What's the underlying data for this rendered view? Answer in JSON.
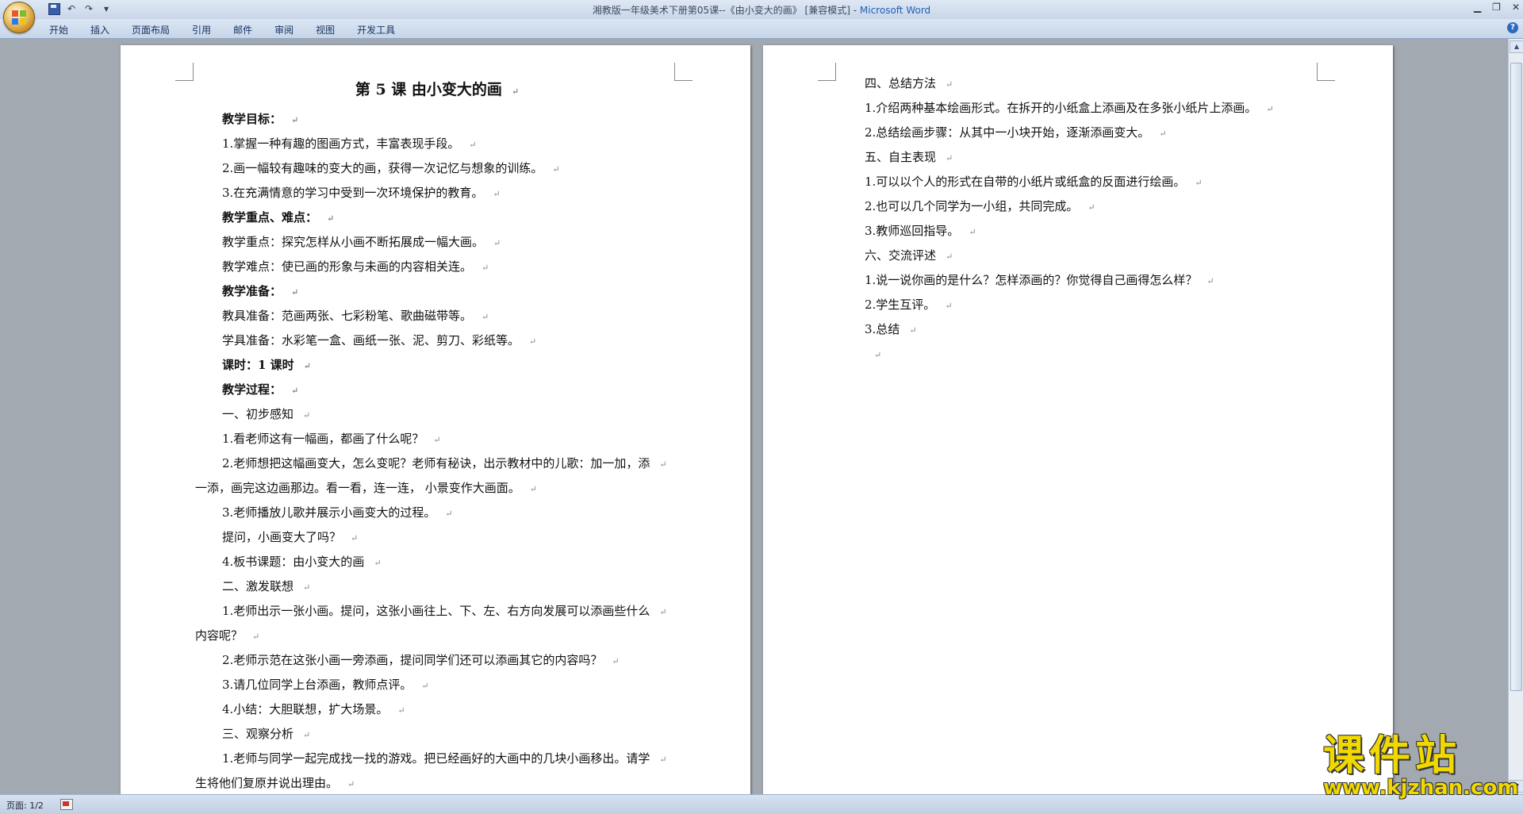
{
  "window": {
    "title_prefix": "湘教版一年级美术下册第05课--《由小变大的画》 [兼容模式] - ",
    "app_name": "Microsoft Word"
  },
  "qat": {
    "undo": "↶",
    "redo": "↷",
    "customize": "▾"
  },
  "ribbon": {
    "tabs": [
      "开始",
      "插入",
      "页面布局",
      "引用",
      "邮件",
      "审阅",
      "视图",
      "开发工具"
    ],
    "help": "?"
  },
  "page1": {
    "title": "第 5 课    由小变大的画",
    "lines": [
      {
        "text": "教学目标：",
        "bold": true
      },
      {
        "text": "1.掌握一种有趣的图画方式，丰富表现手段。"
      },
      {
        "text": "2.画一幅较有趣味的变大的画，获得一次记忆与想象的训练。"
      },
      {
        "text": "3.在充满情意的学习中受到一次环境保护的教育。"
      },
      {
        "text": "教学重点、难点：",
        "bold": true
      },
      {
        "text": "教学重点：探究怎样从小画不断拓展成一幅大画。"
      },
      {
        "text": "教学难点：使已画的形象与未画的内容相关连。"
      },
      {
        "text": "教学准备：",
        "bold": true
      },
      {
        "text": "教具准备：范画两张、七彩粉笔、歌曲磁带等。"
      },
      {
        "text": "学具准备：水彩笔一盒、画纸一张、泥、剪刀、彩纸等。"
      },
      {
        "text": "课时：1 课时",
        "bold": true
      },
      {
        "text": "教学过程：",
        "bold": true
      },
      {
        "text": "一、初步感知"
      },
      {
        "text": "1.看老师这有一幅画，都画了什么呢？"
      },
      {
        "text": "2.老师想把这幅画变大，怎么变呢？老师有秘诀，出示教材中的儿歌：加一加，添"
      },
      {
        "text": "一添，画完这边画那边。看一看，连一连， 小景变作大画面。",
        "noindent": true
      },
      {
        "text": "3.老师播放儿歌并展示小画变大的过程。"
      },
      {
        "text": "提问，小画变大了吗？"
      },
      {
        "text": "4.板书课题：由小变大的画"
      },
      {
        "text": "二、激发联想"
      },
      {
        "text": "1.老师出示一张小画。提问，这张小画往上、下、左、右方向发展可以添画些什么"
      },
      {
        "text": "内容呢？",
        "noindent": true
      },
      {
        "text": "2.老师示范在这张小画一旁添画，提问同学们还可以添画其它的内容吗？"
      },
      {
        "text": "3.请几位同学上台添画，教师点评。"
      },
      {
        "text": "4.小结：大胆联想，扩大场景。"
      },
      {
        "text": "三、观察分析"
      },
      {
        "text": "1.老师与同学一起完成找一找的游戏。把已经画好的大画中的几块小画移出。请学"
      },
      {
        "text": "生将他们复原并说出理由。",
        "noindent": true
      }
    ]
  },
  "page2": {
    "lines": [
      {
        "text": "四、总结方法"
      },
      {
        "text": "1.介绍两种基本绘画形式。在拆开的小纸盒上添画及在多张小纸片上添画。"
      },
      {
        "text": "2.总结绘画步骤：从其中一小块开始，逐渐添画变大。"
      },
      {
        "text": "五、自主表现"
      },
      {
        "text": "1.可以以个人的形式在自带的小纸片或纸盒的反面进行绘画。"
      },
      {
        "text": "2.也可以几个同学为一小组，共同完成。"
      },
      {
        "text": "3.教师巡回指导。"
      },
      {
        "text": "六、交流评述"
      },
      {
        "text": "1.说一说你画的是什么？怎样添画的？你觉得自己画得怎么样？"
      },
      {
        "text": "2.学生互评。"
      },
      {
        "text": "3.总结"
      },
      {
        "text": ""
      }
    ]
  },
  "paragraph_mark": "↵",
  "status": {
    "page": "页面: 1/2"
  },
  "watermark": {
    "cn": "课件站",
    "url": "www.kjzhan.com"
  }
}
